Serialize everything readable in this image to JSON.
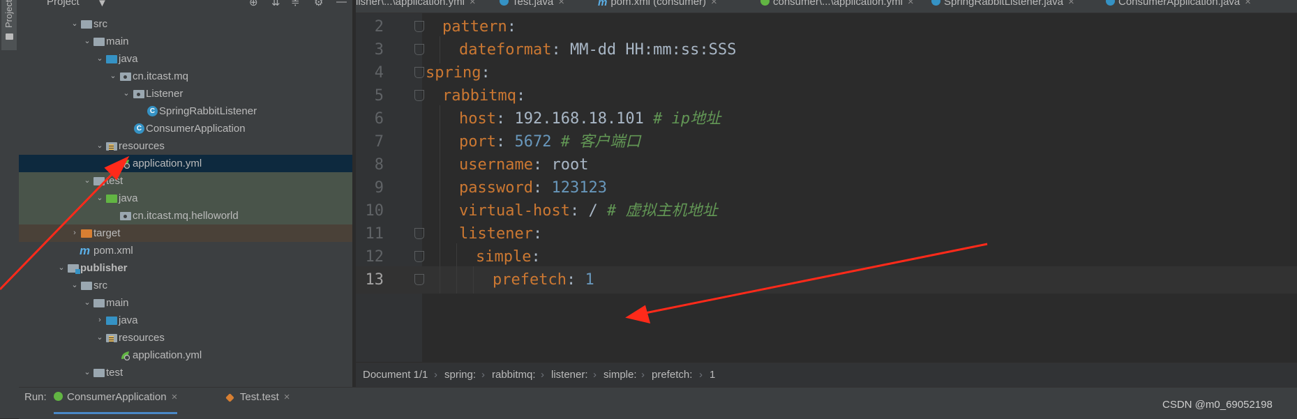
{
  "side_strip": {
    "project_tab_label": "Project"
  },
  "project_panel": {
    "header": {
      "title": "Project",
      "caret": "▼",
      "icons": [
        "target-icon",
        "collapse-all-icon",
        "expand-icon",
        "gear-icon",
        "minimize-icon"
      ]
    },
    "tree": [
      {
        "label": "src",
        "icon": "folder",
        "expanded": true
      },
      {
        "label": "main",
        "icon": "folder",
        "expanded": true
      },
      {
        "label": "java",
        "icon": "source-folder",
        "expanded": true
      },
      {
        "label": "cn.itcast.mq",
        "icon": "package",
        "expanded": true
      },
      {
        "label": "Listener",
        "icon": "package",
        "expanded": true
      },
      {
        "label": "SpringRabbitListener",
        "icon": "class"
      },
      {
        "label": "ConsumerApplication",
        "icon": "spring-class"
      },
      {
        "label": "resources",
        "icon": "resources-folder",
        "expanded": true
      },
      {
        "label": "application.yml",
        "icon": "yaml",
        "selected": true
      },
      {
        "label": "test",
        "icon": "folder",
        "expanded": true
      },
      {
        "label": "java",
        "icon": "test-source-folder",
        "expanded": true
      },
      {
        "label": "cn.itcast.mq.helloworld",
        "icon": "package"
      },
      {
        "label": "target",
        "icon": "excluded-folder",
        "expanded": false
      },
      {
        "label": "pom.xml",
        "icon": "maven"
      },
      {
        "label": "publisher",
        "icon": "module",
        "expanded": true
      },
      {
        "label": "src",
        "icon": "folder",
        "expanded": true
      },
      {
        "label": "main",
        "icon": "folder",
        "expanded": true
      },
      {
        "label": "java",
        "icon": "source-folder",
        "expanded": false
      },
      {
        "label": "resources",
        "icon": "resources-folder",
        "expanded": true
      },
      {
        "label": "application.yml",
        "icon": "yaml"
      },
      {
        "label": "test",
        "icon": "folder",
        "expanded": true
      }
    ]
  },
  "editor_tabs": [
    {
      "label": "lisher\\...\\application.yml",
      "icon": "yaml"
    },
    {
      "label": "Test.java",
      "icon": "class"
    },
    {
      "label": "pom.xml (consumer)",
      "icon": "maven"
    },
    {
      "label": "consumer\\...\\application.yml",
      "icon": "yaml",
      "active": true
    },
    {
      "label": "SpringRabbitListener.java",
      "icon": "class"
    },
    {
      "label": "ConsumerApplication.java",
      "icon": "class"
    }
  ],
  "editor": {
    "current_line": 13,
    "lines": [
      {
        "num": "2",
        "key": "pattern",
        "value": "",
        "comment": ""
      },
      {
        "num": "3",
        "key": "dateformat",
        "value": "MM-dd HH:mm:ss:SSS",
        "comment": ""
      },
      {
        "num": "4",
        "key": "spring",
        "value": "",
        "comment": ""
      },
      {
        "num": "5",
        "key": "rabbitmq",
        "value": "",
        "comment": ""
      },
      {
        "num": "6",
        "key": "host",
        "value": "192.168.18.101",
        "comment": "# ip地址"
      },
      {
        "num": "7",
        "key": "port",
        "value": "5672",
        "comment": "# 客户端口"
      },
      {
        "num": "8",
        "key": "username",
        "value": "root",
        "comment": ""
      },
      {
        "num": "9",
        "key": "password",
        "value": "123123",
        "comment": ""
      },
      {
        "num": "10",
        "key": "virtual-host",
        "value": "/",
        "comment": "# 虚拟主机地址"
      },
      {
        "num": "11",
        "key": "listener",
        "value": "",
        "comment": ""
      },
      {
        "num": "12",
        "key": "simple",
        "value": "",
        "comment": ""
      },
      {
        "num": "13",
        "key": "prefetch",
        "value": "1",
        "comment": ""
      }
    ]
  },
  "breadcrumb": {
    "document": "Document 1/1",
    "path": [
      "spring:",
      "rabbitmq:",
      "listener:",
      "simple:",
      "prefetch:",
      "1"
    ]
  },
  "run_bar": {
    "label": "Run:",
    "tabs": [
      {
        "label": "ConsumerApplication",
        "icon": "spring-run",
        "active": true
      },
      {
        "label": "Test.test",
        "icon": "test-run"
      }
    ]
  },
  "watermark": "CSDN @m0_69052198",
  "colors": {
    "keyword": "#cc7832",
    "number": "#6897bb",
    "comment": "#629755",
    "selection": "#0d293e",
    "annotation_arrow": "#ff2a1a"
  }
}
